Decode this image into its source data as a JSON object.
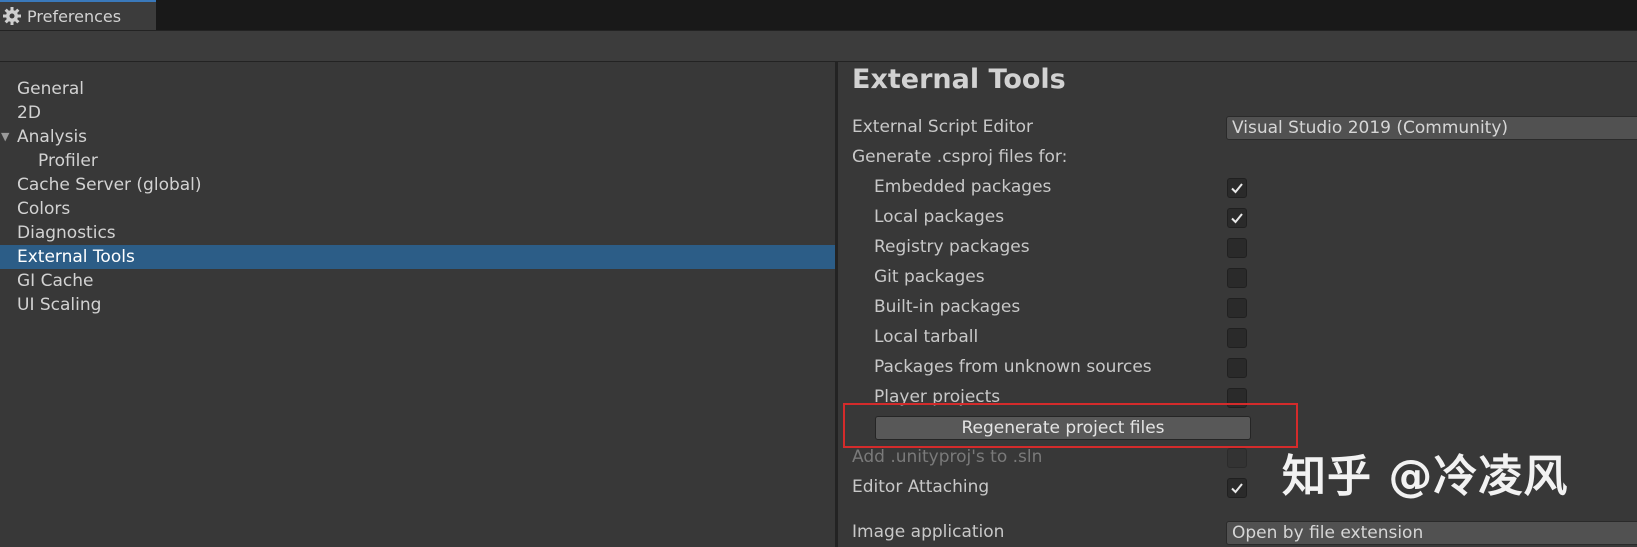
{
  "window": {
    "tab_title": "Preferences",
    "tab_icon": "gear-icon"
  },
  "sidebar": {
    "items": [
      {
        "label": "General"
      },
      {
        "label": "2D"
      },
      {
        "label": "Analysis"
      },
      {
        "label": "Profiler"
      },
      {
        "label": "Cache Server (global)"
      },
      {
        "label": "Colors"
      },
      {
        "label": "Diagnostics"
      },
      {
        "label": "External Tools"
      },
      {
        "label": "GI Cache"
      },
      {
        "label": "UI Scaling"
      }
    ],
    "selected": "External Tools"
  },
  "panel": {
    "title": "External Tools",
    "script_editor": {
      "label": "External Script Editor",
      "value": "Visual Studio 2019 (Community)"
    },
    "generate_label": "Generate .csproj files for:",
    "packages": [
      {
        "label": "Embedded packages",
        "checked": true
      },
      {
        "label": "Local packages",
        "checked": true
      },
      {
        "label": "Registry packages",
        "checked": false
      },
      {
        "label": "Git packages",
        "checked": false
      },
      {
        "label": "Built-in packages",
        "checked": false
      },
      {
        "label": "Local tarball",
        "checked": false
      },
      {
        "label": "Packages from unknown sources",
        "checked": false
      },
      {
        "label": "Player projects",
        "checked": false
      }
    ],
    "regenerate_button": "Regenerate project files",
    "unityproj": {
      "label": "Add .unityproj's to .sln",
      "checked": false,
      "disabled": true
    },
    "editor_attaching": {
      "label": "Editor Attaching",
      "checked": true
    },
    "image_app": {
      "label": "Image application",
      "value": "Open by file extension"
    }
  },
  "watermark": "知乎 @冷凌风",
  "colors": {
    "selection": "#2c5d87",
    "highlight_box": "#d42b2b",
    "tab_accent": "#3a79bb"
  }
}
